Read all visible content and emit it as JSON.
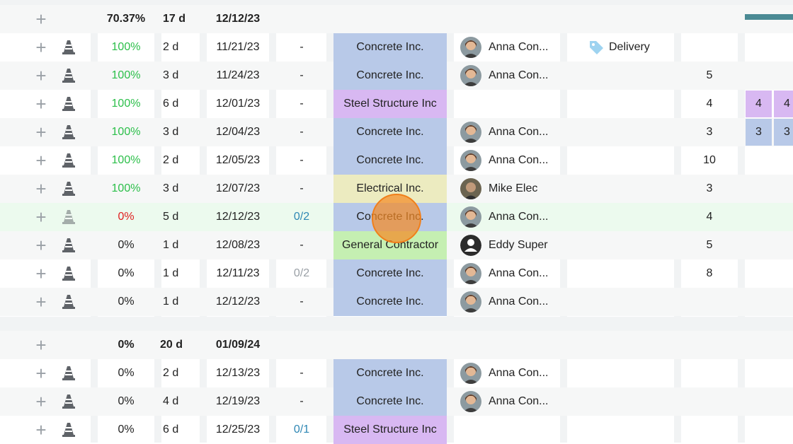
{
  "colors": {
    "concrete": "#b8c9e8",
    "steel": "#d8b8f2",
    "electrical": "#ecebc0",
    "general": "#c5efb2",
    "gantt_bar": "#4b8a94",
    "cursor": "#f48a26"
  },
  "icons": {
    "add": "plus-icon",
    "task": "traffic-cone-icon",
    "tag": "tag-icon",
    "avatar_photo": "avatar-photo",
    "avatar_default": "avatar-default-icon"
  },
  "group1": {
    "add_label": "+",
    "progress": "70.37%",
    "duration": "17 d",
    "end_date": "12/12/23"
  },
  "group2": {
    "add_label": "+",
    "progress": "0%",
    "duration": "20 d",
    "end_date": "01/09/24"
  },
  "rows": [
    {
      "progress": "100%",
      "duration": "2 d",
      "date": "11/21/23",
      "checklist": "-",
      "company": "Concrete Inc.",
      "assignee": "Anna Con...",
      "tag": "Delivery",
      "count": ""
    },
    {
      "progress": "100%",
      "duration": "3 d",
      "date": "11/24/23",
      "checklist": "-",
      "company": "Concrete Inc.",
      "assignee": "Anna Con...",
      "tag": "",
      "count": "5"
    },
    {
      "progress": "100%",
      "duration": "6 d",
      "date": "12/01/23",
      "checklist": "-",
      "company": "Steel Structure Inc",
      "assignee": "",
      "tag": "",
      "count": "4"
    },
    {
      "progress": "100%",
      "duration": "3 d",
      "date": "12/04/23",
      "checklist": "-",
      "company": "Concrete Inc.",
      "assignee": "Anna Con...",
      "tag": "",
      "count": "3"
    },
    {
      "progress": "100%",
      "duration": "2 d",
      "date": "12/05/23",
      "checklist": "-",
      "company": "Concrete Inc.",
      "assignee": "Anna Con...",
      "tag": "",
      "count": "10"
    },
    {
      "progress": "100%",
      "duration": "3 d",
      "date": "12/07/23",
      "checklist": "-",
      "company": "Electrical Inc.",
      "assignee": "Mike Elec",
      "tag": "",
      "count": "3"
    },
    {
      "progress": "0%",
      "duration": "5 d",
      "date": "12/12/23",
      "checklist": "0/2",
      "company": "Concrete Inc.",
      "assignee": "Anna Con...",
      "tag": "",
      "count": "4"
    },
    {
      "progress": "0%",
      "duration": "1 d",
      "date": "12/08/23",
      "checklist": "-",
      "company": "General Contractor",
      "assignee": "Eddy Super",
      "tag": "",
      "count": "5"
    },
    {
      "progress": "0%",
      "duration": "1 d",
      "date": "12/11/23",
      "checklist": "0/2",
      "company": "Concrete Inc.",
      "assignee": "Anna Con...",
      "tag": "",
      "count": "8"
    },
    {
      "progress": "0%",
      "duration": "1 d",
      "date": "12/12/23",
      "checklist": "-",
      "company": "Concrete Inc.",
      "assignee": "Anna Con...",
      "tag": "",
      "count": ""
    },
    {
      "progress": "0%",
      "duration": "2 d",
      "date": "12/13/23",
      "checklist": "-",
      "company": "Concrete Inc.",
      "assignee": "Anna Con...",
      "tag": "",
      "count": ""
    },
    {
      "progress": "0%",
      "duration": "4 d",
      "date": "12/19/23",
      "checklist": "-",
      "company": "Concrete Inc.",
      "assignee": "Anna Con...",
      "tag": "",
      "count": ""
    },
    {
      "progress": "0%",
      "duration": "6 d",
      "date": "12/25/23",
      "checklist": "0/1",
      "company": "Steel Structure Inc",
      "assignee": "",
      "tag": "",
      "count": ""
    }
  ],
  "gantt": {
    "steel_values": [
      "4",
      "4"
    ],
    "concrete_values": [
      "3",
      "3"
    ]
  }
}
